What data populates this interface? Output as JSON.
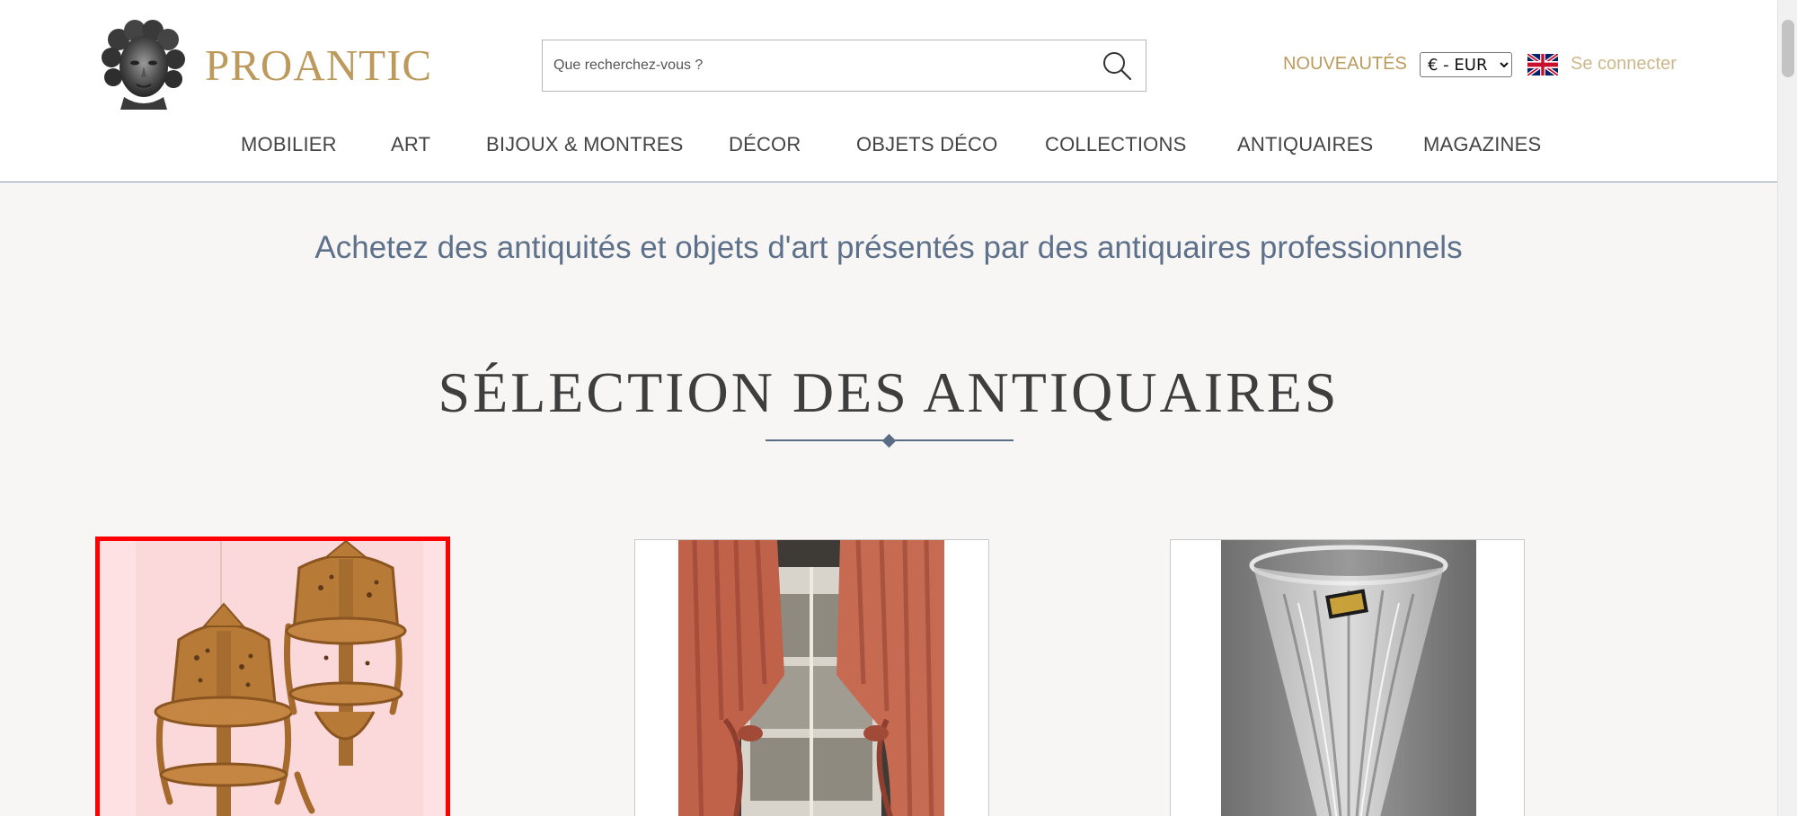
{
  "header": {
    "logo_text": "PROANTIC",
    "search": {
      "placeholder": "Que recherchez-vous ?",
      "value": ""
    },
    "nouveautes": "NOUVEAUTÉS",
    "currency": {
      "selected": "€ - EUR",
      "options": [
        "€ - EUR"
      ]
    },
    "language_flag": "uk-flag-icon",
    "login": "Se connecter"
  },
  "nav": {
    "items": [
      {
        "label": "MOBILIER"
      },
      {
        "label": "ART"
      },
      {
        "label": "BIJOUX & MONTRES"
      },
      {
        "label": "DÉCOR"
      },
      {
        "label": "OBJETS DÉCO"
      },
      {
        "label": "COLLECTIONS"
      },
      {
        "label": "ANTIQUAIRES"
      },
      {
        "label": "MAGAZINES"
      }
    ]
  },
  "main": {
    "tagline": "Achetez des antiquités et objets d'art présentés par des antiquaires professionnels",
    "section_title": "SÉLECTION DES ANTIQUAIRES",
    "products": [
      {
        "icon": "corner-shelves-image",
        "selected": true
      },
      {
        "icon": "curtains-image",
        "selected": false
      },
      {
        "icon": "crystal-vase-image",
        "selected": false
      }
    ]
  },
  "colors": {
    "brand_gold": "#bc9a5c",
    "nav_text": "#444444",
    "tagline_blue": "#5e718a",
    "selection_red": "#ff0000",
    "background": "#f7f6f4"
  }
}
